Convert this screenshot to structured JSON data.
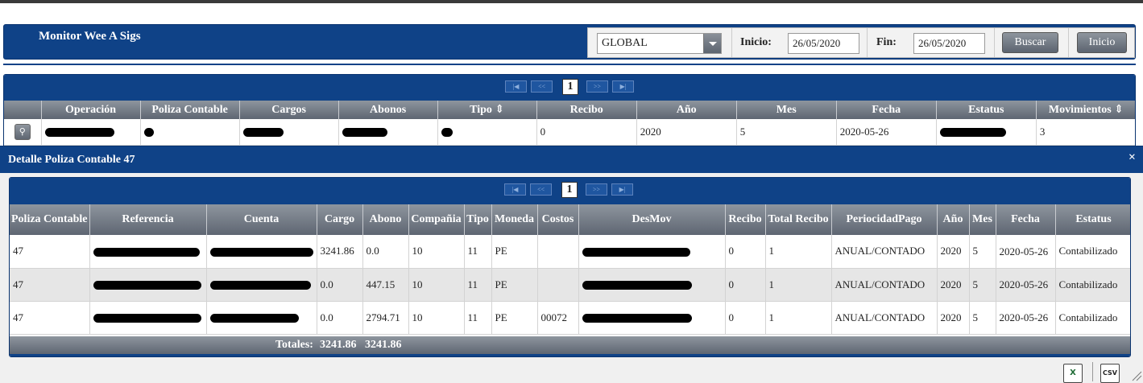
{
  "app": {
    "title": "Monitor Wee A Sigs"
  },
  "filters": {
    "select_value": "GLOBAL",
    "inicio_label": "Inicio:",
    "inicio_value": "26/05/2020",
    "fin_label": "Fin:",
    "fin_value": "26/05/2020",
    "buscar_label": "Buscar",
    "inicio_button_label": "Inicio"
  },
  "main_grid": {
    "pager": {
      "first": "|◀",
      "prev": "<<",
      "page": "1",
      "next": ">>",
      "last": "▶|"
    },
    "columns": [
      "",
      "Operación",
      "Poliza Contable",
      "Cargos",
      "Abonos",
      "Tipo ⇕",
      "Recibo",
      "Año",
      "Mes",
      "Fecha",
      "Estatus",
      "Movimientos ⇕"
    ],
    "row": {
      "recibo": "0",
      "anio": "2020",
      "mes": "5",
      "fecha": "2020-05-26",
      "movimientos": "3"
    }
  },
  "detail": {
    "title": "Detalle Poliza Contable 47",
    "close": "×",
    "pager": {
      "first": "|◀",
      "prev": "<<",
      "page": "1",
      "next": ">>",
      "last": "▶|"
    },
    "columns": [
      "Poliza Contable",
      "Referencia",
      "Cuenta",
      "Cargo",
      "Abono",
      "Compañia",
      "Tipo",
      "Moneda",
      "Costos",
      "DesMov",
      "Recibo",
      "Total Recibo",
      "PeriocidadPago",
      "Año",
      "Mes",
      "Fecha",
      "Estatus"
    ],
    "rows": [
      {
        "poliza": "47",
        "cargo": "3241.86",
        "abono": "0.0",
        "compania": "10",
        "tipo": "11",
        "moneda": "PE",
        "costos": "",
        "recibo": "0",
        "total_recibo": "1",
        "periodicidad": "ANUAL/CONTADO",
        "anio": "2020",
        "mes": "5",
        "fecha": "2020-05-26",
        "estatus": "Contabilizado"
      },
      {
        "poliza": "47",
        "cargo": "0.0",
        "abono": "447.15",
        "compania": "10",
        "tipo": "11",
        "moneda": "PE",
        "costos": "",
        "recibo": "0",
        "total_recibo": "1",
        "periodicidad": "ANUAL/CONTADO",
        "anio": "2020",
        "mes": "5",
        "fecha": "2020-05-26",
        "estatus": "Contabilizado"
      },
      {
        "poliza": "47",
        "cargo": "0.0",
        "abono": "2794.71",
        "compania": "10",
        "tipo": "11",
        "moneda": "PE",
        "costos": "00072",
        "recibo": "0",
        "total_recibo": "1",
        "periodicidad": "ANUAL/CONTADO",
        "anio": "2020",
        "mes": "5",
        "fecha": "2020-05-26",
        "estatus": "Contabilizado"
      }
    ],
    "totals": {
      "label": "Totales:",
      "cargo": "3241.86",
      "abono": "3241.86"
    }
  },
  "export": {
    "excel_icon": "excel-export-icon",
    "csv_icon": "csv-export-icon",
    "excel_text": "X",
    "csv_text": "CSV"
  },
  "colors": {
    "header_blue": "#0f4287",
    "grid_header_gray": "#6b727d"
  }
}
